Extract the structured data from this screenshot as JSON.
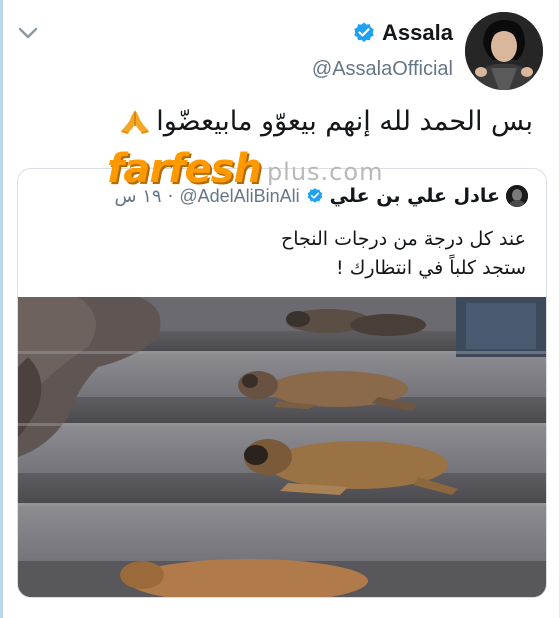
{
  "tweet": {
    "display_name": "Assala",
    "handle": "@AssalaOfficial",
    "text": "بس الحمد لله إنهم بيعوّو مابيعضّوا",
    "emoji_icon": "folded-hands-icon",
    "more_icon": "chevron-down-icon",
    "verified_icon": "verified-badge-icon"
  },
  "watermark": {
    "main": "farfesh",
    "sub": "plus.com",
    "colors": {
      "main": "#ff9900",
      "sub": "#b9b9b9"
    }
  },
  "quoted_tweet": {
    "display_name": "عادل علي بن علي",
    "handle": "@AdelAliBinAli",
    "separator": "·",
    "time": "١٩ س",
    "lines": [
      "عند كل درجة من درجات النجاح",
      "ستجد كلباً في انتظارك !"
    ],
    "photo_icon": "dogs-sleeping-on-stairs-photo"
  },
  "colors": {
    "verified_blue": "#1da1f2",
    "text": "#14171a",
    "secondary_text": "#657786",
    "border": "#d8dee3",
    "accent_rail": "#bcd6ea"
  }
}
